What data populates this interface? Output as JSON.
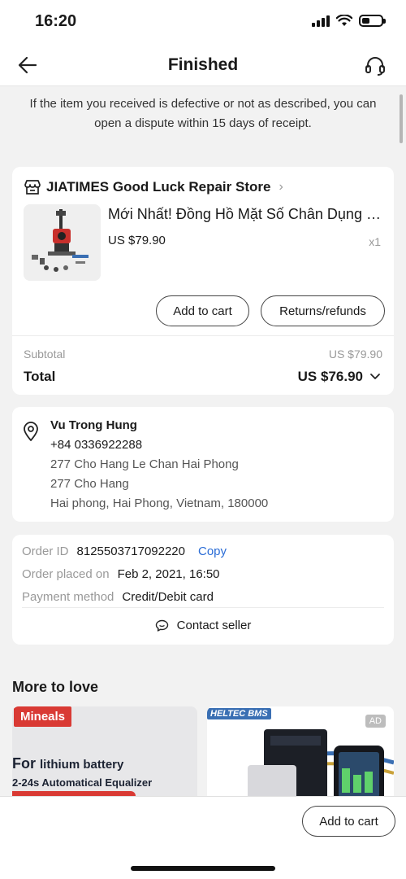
{
  "status_bar": {
    "time": "16:20"
  },
  "nav": {
    "title": "Finished",
    "back_icon": "arrow-left-icon",
    "support_icon": "headset-icon"
  },
  "notice": "If the item you received is defective or not as described, you can open a dispute within 15 days of receipt.",
  "store": {
    "name": "JIATIMES Good Luck Repair Store",
    "product_title": "Mới Nhất! Đồng Hồ Mặt Số Chân Dụng C...",
    "price": "US $79.90",
    "quantity": "x1",
    "add_to_cart": "Add to cart",
    "returns": "Returns/refunds",
    "subtotal_label": "Subtotal",
    "subtotal_value": "US $79.90",
    "total_label": "Total",
    "total_value": "US $76.90"
  },
  "address": {
    "name": "Vu Trong Hung",
    "phone": "+84 0336922288",
    "line1": "277 Cho Hang Le Chan Hai Phong",
    "line2": "277 Cho Hang",
    "line3": "Hai phong, Hai Phong, Vietnam, 180000"
  },
  "order": {
    "id_label": "Order ID",
    "id_value": "8125503717092220",
    "copy": "Copy",
    "placed_label": "Order placed on",
    "placed_value": "Feb 2, 2021, 16:50",
    "payment_label": "Payment method",
    "payment_value": "Credit/Debit card",
    "contact": "Contact seller"
  },
  "more": {
    "title": "More to love",
    "ad_left": {
      "brand": "Mineals",
      "line1_big": "For",
      "line1_small": "lithium battery",
      "line2": "2-24s Automatical Equalizer"
    },
    "ad_right": {
      "logo": "HELTEC BMS",
      "badge": "AD"
    }
  },
  "bottom": {
    "add_to_cart": "Add to cart"
  },
  "colors": {
    "link": "#2a6cd6",
    "brand_red": "#d93a34",
    "background": "#f2f2f2"
  }
}
